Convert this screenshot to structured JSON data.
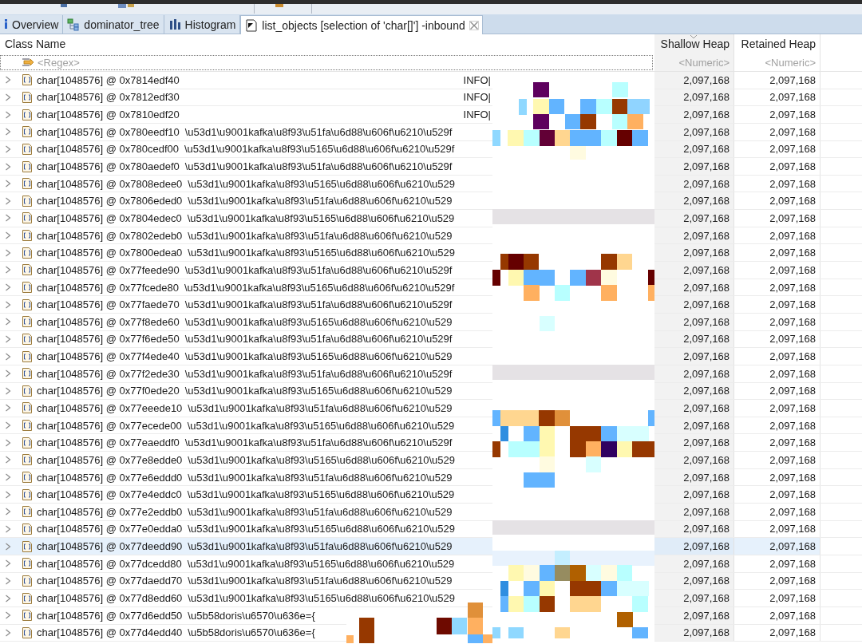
{
  "tabs": [
    {
      "label": "Overview",
      "kind": "info",
      "selected": false,
      "closable": false
    },
    {
      "label": "dominator_tree",
      "kind": "tree",
      "selected": false,
      "closable": false
    },
    {
      "label": "Histogram",
      "kind": "bars",
      "selected": false,
      "closable": false
    },
    {
      "label": "list_objects [selection of 'char[]'] -inbound",
      "kind": "doc",
      "selected": true,
      "closable": true
    }
  ],
  "table": {
    "columns": [
      {
        "label": "Class Name",
        "placeholder": "<Regex>",
        "sorted": false
      },
      {
        "label": "Shallow Heap",
        "placeholder": "<Numeric>",
        "sorted": true
      },
      {
        "label": "Retained Heap",
        "placeholder": "<Numeric>",
        "sorted": false
      }
    ],
    "rows": [
      {
        "class_name": "char[1048576] @ 0x7814edf40",
        "kind": "log",
        "value": "INFO|",
        "shallow_heap": "2,097,168",
        "retained_heap": "2,097,168",
        "selected": false
      },
      {
        "class_name": "char[1048576] @ 0x7812edf30",
        "kind": "log",
        "value": "INFO|",
        "shallow_heap": "2,097,168",
        "retained_heap": "2,097,168",
        "selected": false
      },
      {
        "class_name": "char[1048576] @ 0x7810edf20",
        "kind": "log",
        "value": "INFO|",
        "shallow_heap": "2,097,168",
        "retained_heap": "2,097,168",
        "selected": false
      },
      {
        "class_name": "char[1048576] @ 0x780eedf10",
        "kind": "text",
        "value": "\\u53d1\\u9001kafka\\u8f93\\u51fa\\u6d88\\u606f\\u6210\\u529f",
        "shallow_heap": "2,097,168",
        "retained_heap": "2,097,168",
        "selected": false
      },
      {
        "class_name": "char[1048576] @ 0x780cedf00",
        "kind": "text",
        "value": "\\u53d1\\u9001kafka\\u8f93\\u5165\\u6d88\\u606f\\u6210\\u529f",
        "shallow_heap": "2,097,168",
        "retained_heap": "2,097,168",
        "selected": false
      },
      {
        "class_name": "char[1048576] @ 0x780aedef0",
        "kind": "text",
        "value": "\\u53d1\\u9001kafka\\u8f93\\u51fa\\u6d88\\u606f\\u6210\\u529f",
        "shallow_heap": "2,097,168",
        "retained_heap": "2,097,168",
        "selected": false
      },
      {
        "class_name": "char[1048576] @ 0x7808edee0",
        "kind": "text",
        "value": "\\u53d1\\u9001kafka\\u8f93\\u5165\\u6d88\\u606f\\u6210\\u529",
        "shallow_heap": "2,097,168",
        "retained_heap": "2,097,168",
        "selected": false
      },
      {
        "class_name": "char[1048576] @ 0x7806eded0",
        "kind": "text",
        "value": "\\u53d1\\u9001kafka\\u8f93\\u51fa\\u6d88\\u606f\\u6210\\u529",
        "shallow_heap": "2,097,168",
        "retained_heap": "2,097,168",
        "selected": false
      },
      {
        "class_name": "char[1048576] @ 0x7804edec0",
        "kind": "text",
        "value": "\\u53d1\\u9001kafka\\u8f93\\u5165\\u6d88\\u606f\\u6210\\u529",
        "shallow_heap": "2,097,168",
        "retained_heap": "2,097,168",
        "selected": false
      },
      {
        "class_name": "char[1048576] @ 0x7802edeb0",
        "kind": "text",
        "value": "\\u53d1\\u9001kafka\\u8f93\\u51fa\\u6d88\\u606f\\u6210\\u529",
        "shallow_heap": "2,097,168",
        "retained_heap": "2,097,168",
        "selected": false
      },
      {
        "class_name": "char[1048576] @ 0x7800edea0",
        "kind": "text",
        "value": "\\u53d1\\u9001kafka\\u8f93\\u5165\\u6d88\\u606f\\u6210\\u529",
        "shallow_heap": "2,097,168",
        "retained_heap": "2,097,168",
        "selected": false
      },
      {
        "class_name": "char[1048576] @ 0x77feede90",
        "kind": "text",
        "value": "\\u53d1\\u9001kafka\\u8f93\\u51fa\\u6d88\\u606f\\u6210\\u529f",
        "shallow_heap": "2,097,168",
        "retained_heap": "2,097,168",
        "selected": false
      },
      {
        "class_name": "char[1048576] @ 0x77fcede80",
        "kind": "text",
        "value": "\\u53d1\\u9001kafka\\u8f93\\u5165\\u6d88\\u606f\\u6210\\u529f",
        "shallow_heap": "2,097,168",
        "retained_heap": "2,097,168",
        "selected": false
      },
      {
        "class_name": "char[1048576] @ 0x77faede70",
        "kind": "text",
        "value": "\\u53d1\\u9001kafka\\u8f93\\u51fa\\u6d88\\u606f\\u6210\\u529f",
        "shallow_heap": "2,097,168",
        "retained_heap": "2,097,168",
        "selected": false
      },
      {
        "class_name": "char[1048576] @ 0x77f8ede60",
        "kind": "text",
        "value": "\\u53d1\\u9001kafka\\u8f93\\u5165\\u6d88\\u606f\\u6210\\u529",
        "shallow_heap": "2,097,168",
        "retained_heap": "2,097,168",
        "selected": false
      },
      {
        "class_name": "char[1048576] @ 0x77f6ede50",
        "kind": "text",
        "value": "\\u53d1\\u9001kafka\\u8f93\\u51fa\\u6d88\\u606f\\u6210\\u529f",
        "shallow_heap": "2,097,168",
        "retained_heap": "2,097,168",
        "selected": false
      },
      {
        "class_name": "char[1048576] @ 0x77f4ede40",
        "kind": "text",
        "value": "\\u53d1\\u9001kafka\\u8f93\\u5165\\u6d88\\u606f\\u6210\\u529",
        "shallow_heap": "2,097,168",
        "retained_heap": "2,097,168",
        "selected": false
      },
      {
        "class_name": "char[1048576] @ 0x77f2ede30",
        "kind": "text",
        "value": "\\u53d1\\u9001kafka\\u8f93\\u51fa\\u6d88\\u606f\\u6210\\u529f",
        "shallow_heap": "2,097,168",
        "retained_heap": "2,097,168",
        "selected": false
      },
      {
        "class_name": "char[1048576] @ 0x77f0ede20",
        "kind": "text",
        "value": "\\u53d1\\u9001kafka\\u8f93\\u5165\\u6d88\\u606f\\u6210\\u529",
        "shallow_heap": "2,097,168",
        "retained_heap": "2,097,168",
        "selected": false
      },
      {
        "class_name": "char[1048576] @ 0x77eeede10",
        "kind": "text",
        "value": "\\u53d1\\u9001kafka\\u8f93\\u51fa\\u6d88\\u606f\\u6210\\u529",
        "shallow_heap": "2,097,168",
        "retained_heap": "2,097,168",
        "selected": false
      },
      {
        "class_name": "char[1048576] @ 0x77ecede00",
        "kind": "text",
        "value": "\\u53d1\\u9001kafka\\u8f93\\u5165\\u6d88\\u606f\\u6210\\u529",
        "shallow_heap": "2,097,168",
        "retained_heap": "2,097,168",
        "selected": false
      },
      {
        "class_name": "char[1048576] @ 0x77eaeddf0",
        "kind": "text",
        "value": "\\u53d1\\u9001kafka\\u8f93\\u51fa\\u6d88\\u606f\\u6210\\u529f",
        "shallow_heap": "2,097,168",
        "retained_heap": "2,097,168",
        "selected": false
      },
      {
        "class_name": "char[1048576] @ 0x77e8edde0",
        "kind": "text",
        "value": "\\u53d1\\u9001kafka\\u8f93\\u5165\\u6d88\\u606f\\u6210\\u529",
        "shallow_heap": "2,097,168",
        "retained_heap": "2,097,168",
        "selected": false
      },
      {
        "class_name": "char[1048576] @ 0x77e6eddd0",
        "kind": "text",
        "value": "\\u53d1\\u9001kafka\\u8f93\\u51fa\\u6d88\\u606f\\u6210\\u529",
        "shallow_heap": "2,097,168",
        "retained_heap": "2,097,168",
        "selected": false
      },
      {
        "class_name": "char[1048576] @ 0x77e4eddc0",
        "kind": "text",
        "value": "\\u53d1\\u9001kafka\\u8f93\\u5165\\u6d88\\u606f\\u6210\\u529",
        "shallow_heap": "2,097,168",
        "retained_heap": "2,097,168",
        "selected": false
      },
      {
        "class_name": "char[1048576] @ 0x77e2eddb0",
        "kind": "text",
        "value": "\\u53d1\\u9001kafka\\u8f93\\u51fa\\u6d88\\u606f\\u6210\\u529",
        "shallow_heap": "2,097,168",
        "retained_heap": "2,097,168",
        "selected": false
      },
      {
        "class_name": "char[1048576] @ 0x77e0edda0",
        "kind": "text",
        "value": "\\u53d1\\u9001kafka\\u8f93\\u5165\\u6d88\\u606f\\u6210\\u529",
        "shallow_heap": "2,097,168",
        "retained_heap": "2,097,168",
        "selected": false
      },
      {
        "class_name": "char[1048576] @ 0x77deedd90",
        "kind": "text",
        "value": "\\u53d1\\u9001kafka\\u8f93\\u51fa\\u6d88\\u606f\\u6210\\u529",
        "shallow_heap": "2,097,168",
        "retained_heap": "2,097,168",
        "selected": true
      },
      {
        "class_name": "char[1048576] @ 0x77dcedd80",
        "kind": "text",
        "value": "\\u53d1\\u9001kafka\\u8f93\\u5165\\u6d88\\u606f\\u6210\\u529",
        "shallow_heap": "2,097,168",
        "retained_heap": "2,097,168",
        "selected": false
      },
      {
        "class_name": "char[1048576] @ 0x77daedd70",
        "kind": "text",
        "value": "\\u53d1\\u9001kafka\\u8f93\\u51fa\\u6d88\\u606f\\u6210\\u529",
        "shallow_heap": "2,097,168",
        "retained_heap": "2,097,168",
        "selected": false
      },
      {
        "class_name": "char[1048576] @ 0x77d8edd60",
        "kind": "text",
        "value": "\\u53d1\\u9001kafka\\u8f93\\u5165\\u6d88\\u606f\\u6210\\u529",
        "shallow_heap": "2,097,168",
        "retained_heap": "2,097,168",
        "selected": false
      },
      {
        "class_name": "char[1048576] @ 0x77d6edd50",
        "kind": "text",
        "value": "\\u5b58doris\\u6570\\u636e={",
        "shallow_heap": "2,097,168",
        "retained_heap": "2,097,168",
        "selected": false
      },
      {
        "class_name": "char[1048576] @ 0x77d4edd40",
        "kind": "text",
        "value": "\\u5b58doris\\u6570\\u636e={",
        "shallow_heap": "2,097,168",
        "retained_heap": "2,097,168",
        "selected": false
      }
    ]
  }
}
